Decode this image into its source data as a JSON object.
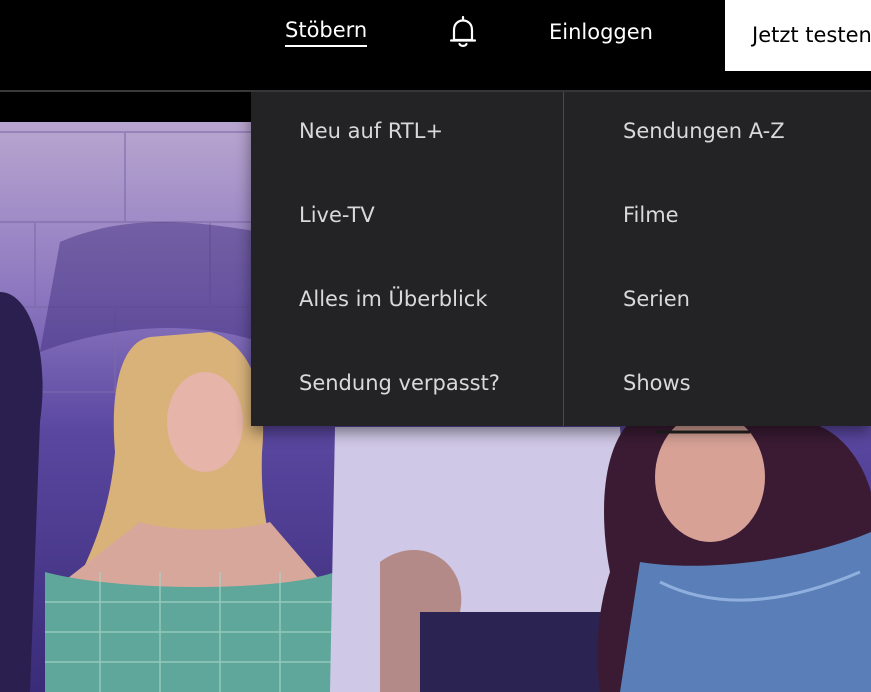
{
  "header": {
    "browse_label": "Stöbern",
    "login_label": "Einloggen",
    "trial_label": "Jetzt testen",
    "bell_icon": "bell-icon"
  },
  "dropdown": {
    "left_column": [
      {
        "label": "Neu auf RTL+"
      },
      {
        "label": "Live-TV"
      },
      {
        "label": "Alles im Überblick"
      },
      {
        "label": "Sendung verpasst?"
      }
    ],
    "right_column": [
      {
        "label": "Sendungen A-Z"
      },
      {
        "label": "Filme"
      },
      {
        "label": "Serien"
      },
      {
        "label": "Shows"
      }
    ]
  },
  "colors": {
    "menu_bg": "#232325",
    "menu_text": "#d9d9db",
    "topbar_bg": "#000000",
    "accent": "#ffffff"
  }
}
